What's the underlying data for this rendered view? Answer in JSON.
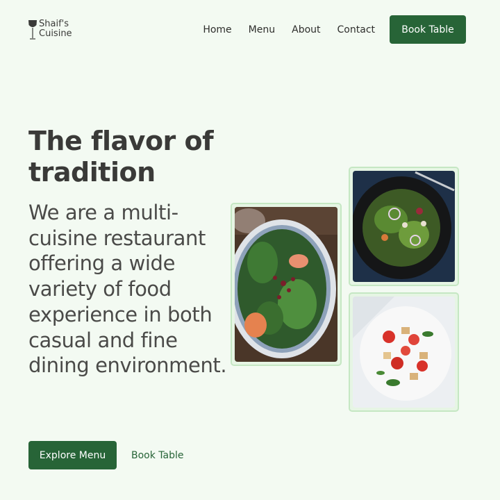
{
  "brand": {
    "name_line1": "Shaif's",
    "name_line2": "Cuisine",
    "logo_icon": "wine-glass-icon"
  },
  "nav": {
    "links": [
      "Home",
      "Menu",
      "About",
      "Contact"
    ],
    "cta": "Book Table"
  },
  "hero": {
    "title": "The flavor of tradition",
    "description": "We are a multi-cuisine restaurant offering a wide variety of food experience in both casual and fine dining environment.",
    "primary_action": "Explore Menu",
    "secondary_action": "Book Table"
  },
  "images": [
    {
      "name": "salad-platter-image"
    },
    {
      "name": "dark-bowl-salad-image"
    },
    {
      "name": "tomato-crouton-salad-image"
    }
  ],
  "colors": {
    "background": "#f3faf2",
    "accent": "#276437",
    "text": "#3a3a38",
    "image_border": "#c5e7c3"
  }
}
